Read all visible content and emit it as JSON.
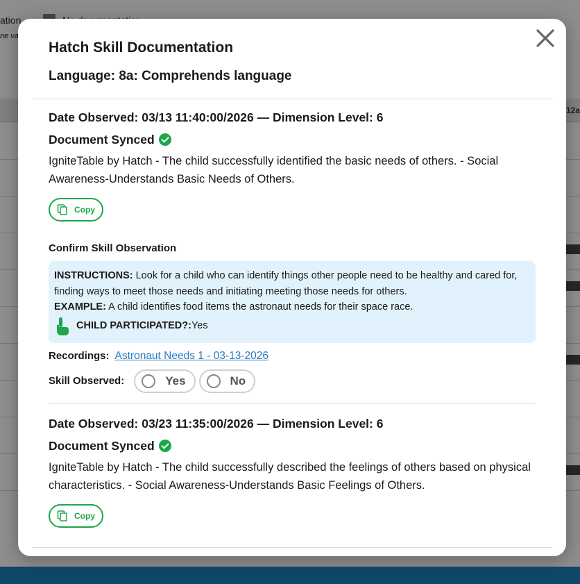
{
  "background": {
    "top_left_text": "ation",
    "top_sub_text": "ne va",
    "documentation_text": "No documentation",
    "column_header": "12a"
  },
  "modal": {
    "title": "Hatch Skill Documentation",
    "subtitle": "Language: 8a: Comprehends language",
    "close_icon": "close-icon",
    "observations": [
      {
        "date_line": "Date Observed: 03/13 11:40:00/2026 — Dimension Level: 6",
        "synced": "Document Synced",
        "description": "IgniteTable by Hatch - The child successfully identified the basic needs of others. - Social Awareness-Understands Basic Needs of Others.",
        "copy_label": "Copy",
        "confirm_title": "Confirm Skill Observation",
        "instructions_label": "INSTRUCTIONS:",
        "instructions_text": " Look for a child who can identify things other people need to be healthy and cared for, finding ways to meet those needs and initiating meeting those needs for others.",
        "example_label": "EXAMPLE:",
        "example_text": " A child identifies food items the astronaut needs for their space race.",
        "participated_label": "CHILD PARTICIPATED?:",
        "participated_value": " Yes",
        "recordings_label": "Recordings:",
        "recording_link": "Astronaut Needs 1 - 03-13-2026",
        "skill_observed_label": "Skill Observed:",
        "options": [
          "Yes",
          "No"
        ]
      },
      {
        "date_line": "Date Observed: 03/23 11:35:00/2026 — Dimension Level: 6",
        "synced": "Document Synced",
        "description": "IgniteTable by Hatch - The child successfully described the feelings of others based on physical characteristics. - Social Awareness-Understands Basic Feelings of Others.",
        "copy_label": "Copy"
      }
    ]
  },
  "colors": {
    "accent_green": "#1ea64a",
    "link_blue": "#2b7cbf",
    "instructions_bg": "#e2f2fc"
  }
}
